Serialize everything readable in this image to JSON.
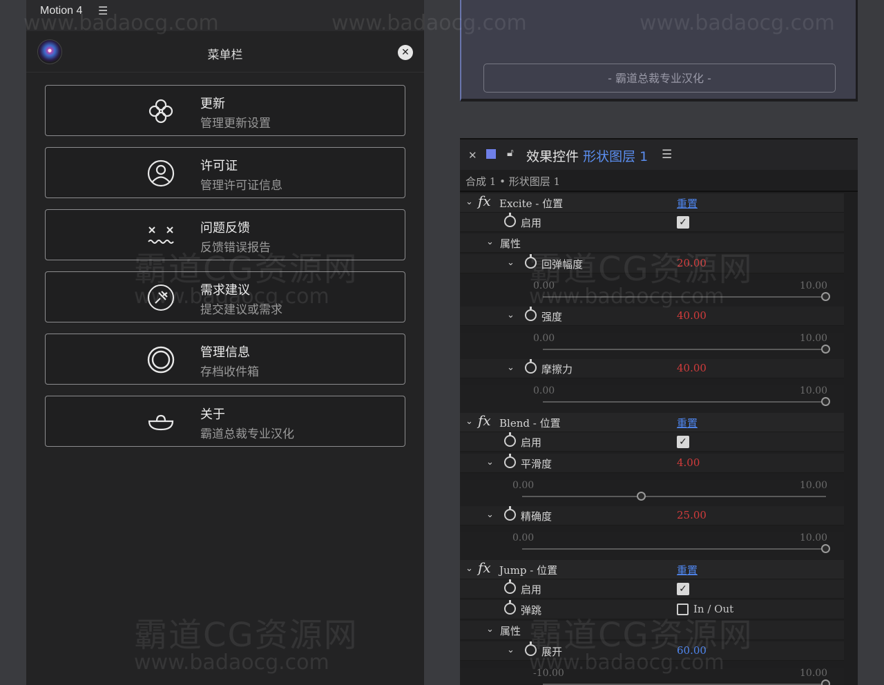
{
  "left_panel": {
    "tab_title": "Motion 4",
    "header_title": "菜单栏",
    "items": [
      {
        "title": "更新",
        "subtitle": "管理更新设置",
        "icon": "flower-icon"
      },
      {
        "title": "许可证",
        "subtitle": "管理许可证信息",
        "icon": "user-icon"
      },
      {
        "title": "问题反馈",
        "subtitle": "反馈错误报告",
        "icon": "dizzy-face-icon"
      },
      {
        "title": "需求建议",
        "subtitle": "提交建议或需求",
        "icon": "pin-icon"
      },
      {
        "title": "管理信息",
        "subtitle": "存档收件箱",
        "icon": "ring-icon"
      },
      {
        "title": "关于",
        "subtitle": "霸道总裁专业汉化",
        "icon": "bowl-icon"
      }
    ]
  },
  "top_right": {
    "credit": "- 霸道总裁专业汉化 -"
  },
  "fx_panel": {
    "tab_label": "效果控件",
    "tab_layer": "形状图层 1",
    "breadcrumb": "合成 1 • 形状图层 1",
    "reset_label": "重置",
    "enable_label": "启用",
    "props_label": "属性",
    "excite": {
      "name": "Excite - 位置",
      "bounce_label": "回弹幅度",
      "bounce_value": "20.00",
      "bounce_min": "0.00",
      "bounce_max": "10.00",
      "strength_label": "强度",
      "strength_value": "40.00",
      "strength_min": "0.00",
      "strength_max": "10.00",
      "friction_label": "摩擦力",
      "friction_value": "40.00",
      "friction_min": "0.00",
      "friction_max": "10.00"
    },
    "blend": {
      "name": "Blend - 位置",
      "smooth_label": "平滑度",
      "smooth_value": "4.00",
      "smooth_min": "0.00",
      "smooth_max": "10.00",
      "precision_label": "精确度",
      "precision_value": "25.00",
      "precision_min": "0.00",
      "precision_max": "10.00"
    },
    "jump": {
      "name": "Jump - 位置",
      "bounce_label": "弹跳",
      "inout_label": "In / Out",
      "spread_label": "展开",
      "spread_value": "60.00",
      "spread_min": "-10.00",
      "spread_max": "10.00"
    }
  },
  "watermark": {
    "cn": "霸道CG资源网",
    "url": "www.badaocg.com"
  }
}
